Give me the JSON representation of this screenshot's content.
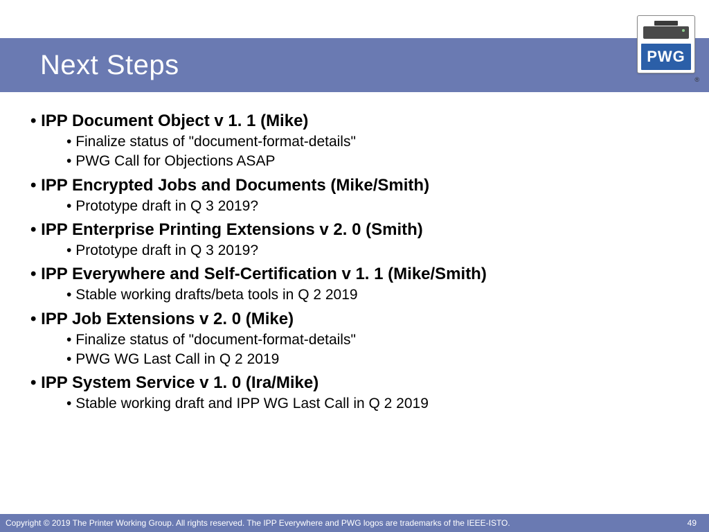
{
  "header": {
    "title": "Next Steps"
  },
  "logo": {
    "text": "PWG",
    "registered": "®"
  },
  "items": [
    {
      "title": "IPP Document Object v 1. 1 (Mike)",
      "subs": [
        "Finalize status of \"document-format-details\"",
        "PWG Call for Objections ASAP"
      ]
    },
    {
      "title": "IPP Encrypted Jobs and Documents (Mike/Smith)",
      "subs": [
        "Prototype draft in Q 3 2019?"
      ]
    },
    {
      "title": "IPP Enterprise Printing Extensions v 2. 0 (Smith)",
      "subs": [
        "Prototype draft in Q 3 2019?"
      ]
    },
    {
      "title": "IPP Everywhere and Self-Certification v 1. 1 (Mike/Smith)",
      "subs": [
        "Stable working drafts/beta tools in Q 2 2019"
      ]
    },
    {
      "title": "IPP Job Extensions v 2. 0 (Mike)",
      "subs": [
        "Finalize status of \"document-format-details\"",
        "PWG WG Last Call in Q 2 2019"
      ]
    },
    {
      "title": "IPP System Service v 1. 0 (Ira/Mike)",
      "subs": [
        "Stable working draft and IPP WG Last Call in Q 2 2019"
      ]
    }
  ],
  "footer": {
    "copyright": "Copyright © 2019 The Printer Working Group. All rights reserved. The IPP Everywhere and PWG logos are trademarks of the IEEE-ISTO.",
    "page": "49"
  }
}
